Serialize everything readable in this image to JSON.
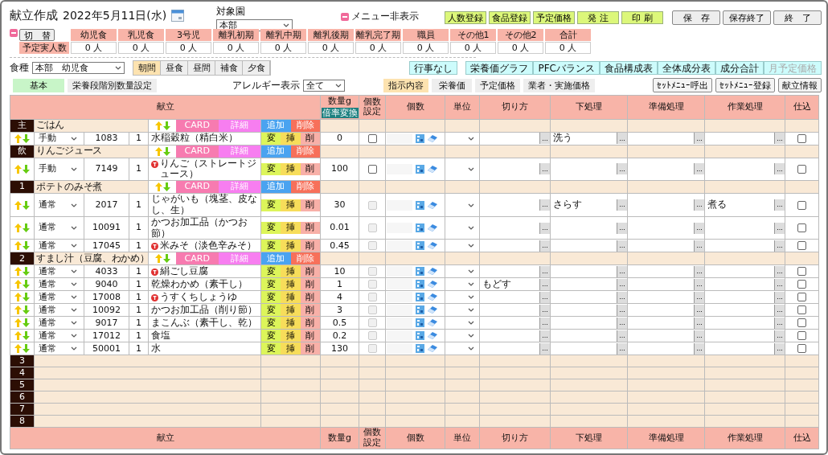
{
  "header": {
    "title": "献立作成",
    "date": "2022年5月11日(水)",
    "facility_label": "対象園",
    "facility": "本部",
    "menu_toggle": "メニュー非表示"
  },
  "actions": [
    {
      "label": "人数登録",
      "kind": "green"
    },
    {
      "label": "食品登録",
      "kind": "green"
    },
    {
      "label": "予定価格",
      "kind": "green"
    },
    {
      "label": "発 注",
      "kind": "green"
    },
    {
      "label": "印 刷",
      "kind": "green"
    },
    {
      "label": "保　存",
      "kind": "grey"
    },
    {
      "label": "保存終了",
      "kind": "grey"
    },
    {
      "label": "終　了",
      "kind": "grey"
    }
  ],
  "headcount": {
    "switch": "切　替",
    "row_label": "予定実人数",
    "columns": [
      {
        "label": "幼児食",
        "value": "0 人"
      },
      {
        "label": "乳児食",
        "value": "0 人"
      },
      {
        "label": "3号児",
        "value": "0 人"
      },
      {
        "label": "離乳初期",
        "value": "0 人"
      },
      {
        "label": "離乳中期",
        "value": "0 人"
      },
      {
        "label": "離乳後期",
        "value": "0 人"
      },
      {
        "label": "離乳完了期",
        "value": "0 人"
      },
      {
        "label": "職員",
        "value": "0 人"
      },
      {
        "label": "その他1",
        "value": "0 人"
      },
      {
        "label": "その他2",
        "value": "0 人"
      },
      {
        "label": "合計",
        "value": "0 人"
      }
    ]
  },
  "meal": {
    "label": "食種",
    "value": "本部　幼児食",
    "tabs": [
      {
        "label": "朝間",
        "selected": true
      },
      {
        "label": "昼食",
        "selected": false
      },
      {
        "label": "昼間",
        "selected": false
      },
      {
        "label": "補食",
        "selected": false
      },
      {
        "label": "夕食",
        "selected": false
      }
    ]
  },
  "event": "行事なし",
  "reports": [
    {
      "label": "栄養価グラフ",
      "disabled": false
    },
    {
      "label": "PFCバランス",
      "disabled": false
    },
    {
      "label": "食品構成表",
      "disabled": false
    },
    {
      "label": "全体成分表",
      "disabled": false
    },
    {
      "label": "成分合計",
      "disabled": false
    },
    {
      "label": "月予定価格",
      "disabled": true
    }
  ],
  "views": [
    {
      "label": "基本",
      "selected": true
    },
    {
      "label": "栄養段階別数量設定",
      "selected": false
    }
  ],
  "allergy": {
    "label": "アレルギー表示",
    "value": "全て"
  },
  "detail_tabs": [
    {
      "label": "指示内容",
      "selected": true
    },
    {
      "label": "栄養価",
      "selected": false
    },
    {
      "label": "予定価格",
      "selected": false
    },
    {
      "label": "業者・実施価格",
      "selected": false
    }
  ],
  "set_buttons": [
    "ｾｯﾄﾒﾆｭｰ呼出",
    "ｾｯﾄﾒﾆｭｰ登録",
    "献立情報"
  ],
  "table": {
    "columns": [
      "献立",
      "数量g",
      "個数設定",
      "個数",
      "単位",
      "切り方",
      "下処理",
      "準備処理",
      "作業処理",
      "仕込"
    ],
    "ratio_button": "倍率変換",
    "groups": [
      {
        "label": "主",
        "name": "ごはん",
        "buttons": [
          "CARD",
          "詳細",
          "追加",
          "削除"
        ],
        "items": [
          {
            "mode": "手動",
            "code": "1083",
            "count": "1",
            "name": "水稲穀粒（精白米）",
            "allergen": false,
            "actions": [
              "変",
              "挿",
              "削"
            ],
            "qty": "0",
            "count_setting": {
              "checked": false,
              "disabled": false
            },
            "fields": [
              {
                "button": "..."
              },
              {
                "value": "洗う",
                "button": "..."
              },
              {
                "button": "..."
              },
              {
                "button": "..."
              }
            ],
            "prep": {
              "checked": false
            }
          }
        ]
      },
      {
        "label": "飲",
        "name": "りんごジュース",
        "buttons": [
          "CARD",
          "詳細",
          "追加",
          "削除"
        ],
        "items": [
          {
            "mode": "手動",
            "code": "7149",
            "count": "1",
            "name": "りんご（ストレートジュース）",
            "allergen": true,
            "actions": [
              "変",
              "挿",
              "削"
            ],
            "qty": "100",
            "count_setting": {
              "checked": false,
              "disabled": false
            },
            "fields": [
              {
                "button": "..."
              },
              {
                "button": "..."
              },
              {
                "button": "..."
              },
              {
                "button": "..."
              }
            ],
            "prep": {
              "checked": false
            }
          }
        ]
      },
      {
        "label": "1",
        "name": "ポテトのみそ煮",
        "buttons": [
          "CARD",
          "詳細",
          "追加",
          "削除"
        ],
        "items": [
          {
            "mode": "通常",
            "code": "2017",
            "count": "1",
            "name": "じゃがいも（塊茎、皮なし、生）",
            "allergen": false,
            "actions": [
              "変",
              "挿",
              "削"
            ],
            "qty": "30",
            "count_setting": {
              "checked": false,
              "disabled": true
            },
            "fields": [
              {
                "button": "..."
              },
              {
                "value": "さらす",
                "button": "..."
              },
              {
                "button": "..."
              },
              {
                "value": "煮る",
                "button": "..."
              }
            ],
            "prep": {
              "checked": false
            }
          },
          {
            "mode": "通常",
            "code": "10091",
            "count": "1",
            "name": "かつお加工品（かつお節）",
            "allergen": false,
            "actions": [
              "変",
              "挿",
              "削"
            ],
            "qty": "0.01",
            "count_setting": {
              "checked": false,
              "disabled": true
            },
            "fields": [
              {
                "button": "..."
              },
              {
                "button": "..."
              },
              {
                "button": "..."
              },
              {
                "button": "..."
              }
            ],
            "prep": {
              "checked": false
            }
          },
          {
            "mode": "通常",
            "code": "17045",
            "count": "1",
            "name": "米みそ（淡色辛みそ）",
            "allergen": true,
            "actions": [
              "変",
              "挿",
              "削"
            ],
            "qty": "0.45",
            "count_setting": {
              "checked": false,
              "disabled": true
            },
            "fields": [
              {
                "button": "..."
              },
              {
                "button": "..."
              },
              {
                "button": "..."
              },
              {
                "button": "..."
              }
            ],
            "prep": {
              "checked": false
            }
          }
        ]
      },
      {
        "label": "2",
        "name": "すまし汁（豆腐、わかめ）",
        "buttons": [
          "CARD",
          "詳細",
          "追加",
          "削除"
        ],
        "items": [
          {
            "mode": "通常",
            "code": "4033",
            "count": "1",
            "name": "絹ごし豆腐",
            "allergen": true,
            "actions": [
              "変",
              "挿",
              "削"
            ],
            "qty": "10",
            "count_setting": {
              "checked": false,
              "disabled": true
            },
            "fields": [
              {
                "button": "..."
              },
              {
                "button": "..."
              },
              {
                "button": "..."
              },
              {
                "button": "..."
              }
            ],
            "prep": {
              "checked": false
            }
          },
          {
            "mode": "通常",
            "code": "9040",
            "count": "1",
            "name": "乾燥わかめ（素干し）",
            "allergen": false,
            "actions": [
              "変",
              "挿",
              "削"
            ],
            "qty": "1",
            "count_setting": {
              "checked": false,
              "disabled": true
            },
            "fields": [
              {
                "value": "もどす",
                "button": "..."
              },
              {
                "button": "..."
              },
              {
                "button": "..."
              },
              {
                "button": "..."
              }
            ],
            "prep": {
              "checked": false
            }
          },
          {
            "mode": "通常",
            "code": "17008",
            "count": "1",
            "name": "うすくちしょうゆ",
            "allergen": true,
            "actions": [
              "変",
              "挿",
              "削"
            ],
            "qty": "4",
            "count_setting": {
              "checked": false,
              "disabled": true
            },
            "fields": [
              {
                "button": "..."
              },
              {
                "button": "..."
              },
              {
                "button": "..."
              },
              {
                "button": "..."
              }
            ],
            "prep": {
              "checked": false
            }
          },
          {
            "mode": "通常",
            "code": "10092",
            "count": "1",
            "name": "かつお加工品（削り節）",
            "allergen": false,
            "actions": [
              "変",
              "挿",
              "削"
            ],
            "qty": "3",
            "count_setting": {
              "checked": false,
              "disabled": true
            },
            "fields": [
              {
                "button": "..."
              },
              {
                "button": "..."
              },
              {
                "button": "..."
              },
              {
                "button": "..."
              }
            ],
            "prep": {
              "checked": false
            }
          },
          {
            "mode": "通常",
            "code": "9017",
            "count": "1",
            "name": "まこんぶ（素干し、乾）",
            "allergen": false,
            "actions": [
              "変",
              "挿",
              "削"
            ],
            "qty": "0.5",
            "count_setting": {
              "checked": false,
              "disabled": true
            },
            "fields": [
              {
                "button": "..."
              },
              {
                "button": "..."
              },
              {
                "button": "..."
              },
              {
                "button": "..."
              }
            ],
            "prep": {
              "checked": false
            }
          },
          {
            "mode": "通常",
            "code": "17012",
            "count": "1",
            "name": "食塩",
            "allergen": false,
            "actions": [
              "変",
              "挿",
              "削"
            ],
            "qty": "0.2",
            "count_setting": {
              "checked": false,
              "disabled": true
            },
            "fields": [
              {
                "button": "..."
              },
              {
                "button": "..."
              },
              {
                "button": "..."
              },
              {
                "button": "..."
              }
            ],
            "prep": {
              "checked": false
            }
          },
          {
            "mode": "通常",
            "code": "50001",
            "count": "1",
            "name": "水",
            "allergen": false,
            "actions": [
              "変",
              "挿",
              "削"
            ],
            "qty": "130",
            "count_setting": {
              "checked": false,
              "disabled": true
            },
            "fields": [
              {
                "button": "..."
              },
              {
                "button": "..."
              },
              {
                "button": "..."
              },
              {
                "button": "..."
              }
            ],
            "prep": {
              "checked": false
            }
          }
        ]
      },
      {
        "label": "3"
      },
      {
        "label": "4"
      },
      {
        "label": "5"
      },
      {
        "label": "6"
      },
      {
        "label": "7"
      },
      {
        "label": "8"
      }
    ],
    "footer": [
      "献立",
      "数量g",
      "個数設定",
      "個数",
      "単位",
      "切り方",
      "下処理",
      "準備処理",
      "作業処理",
      "仕込"
    ]
  }
}
